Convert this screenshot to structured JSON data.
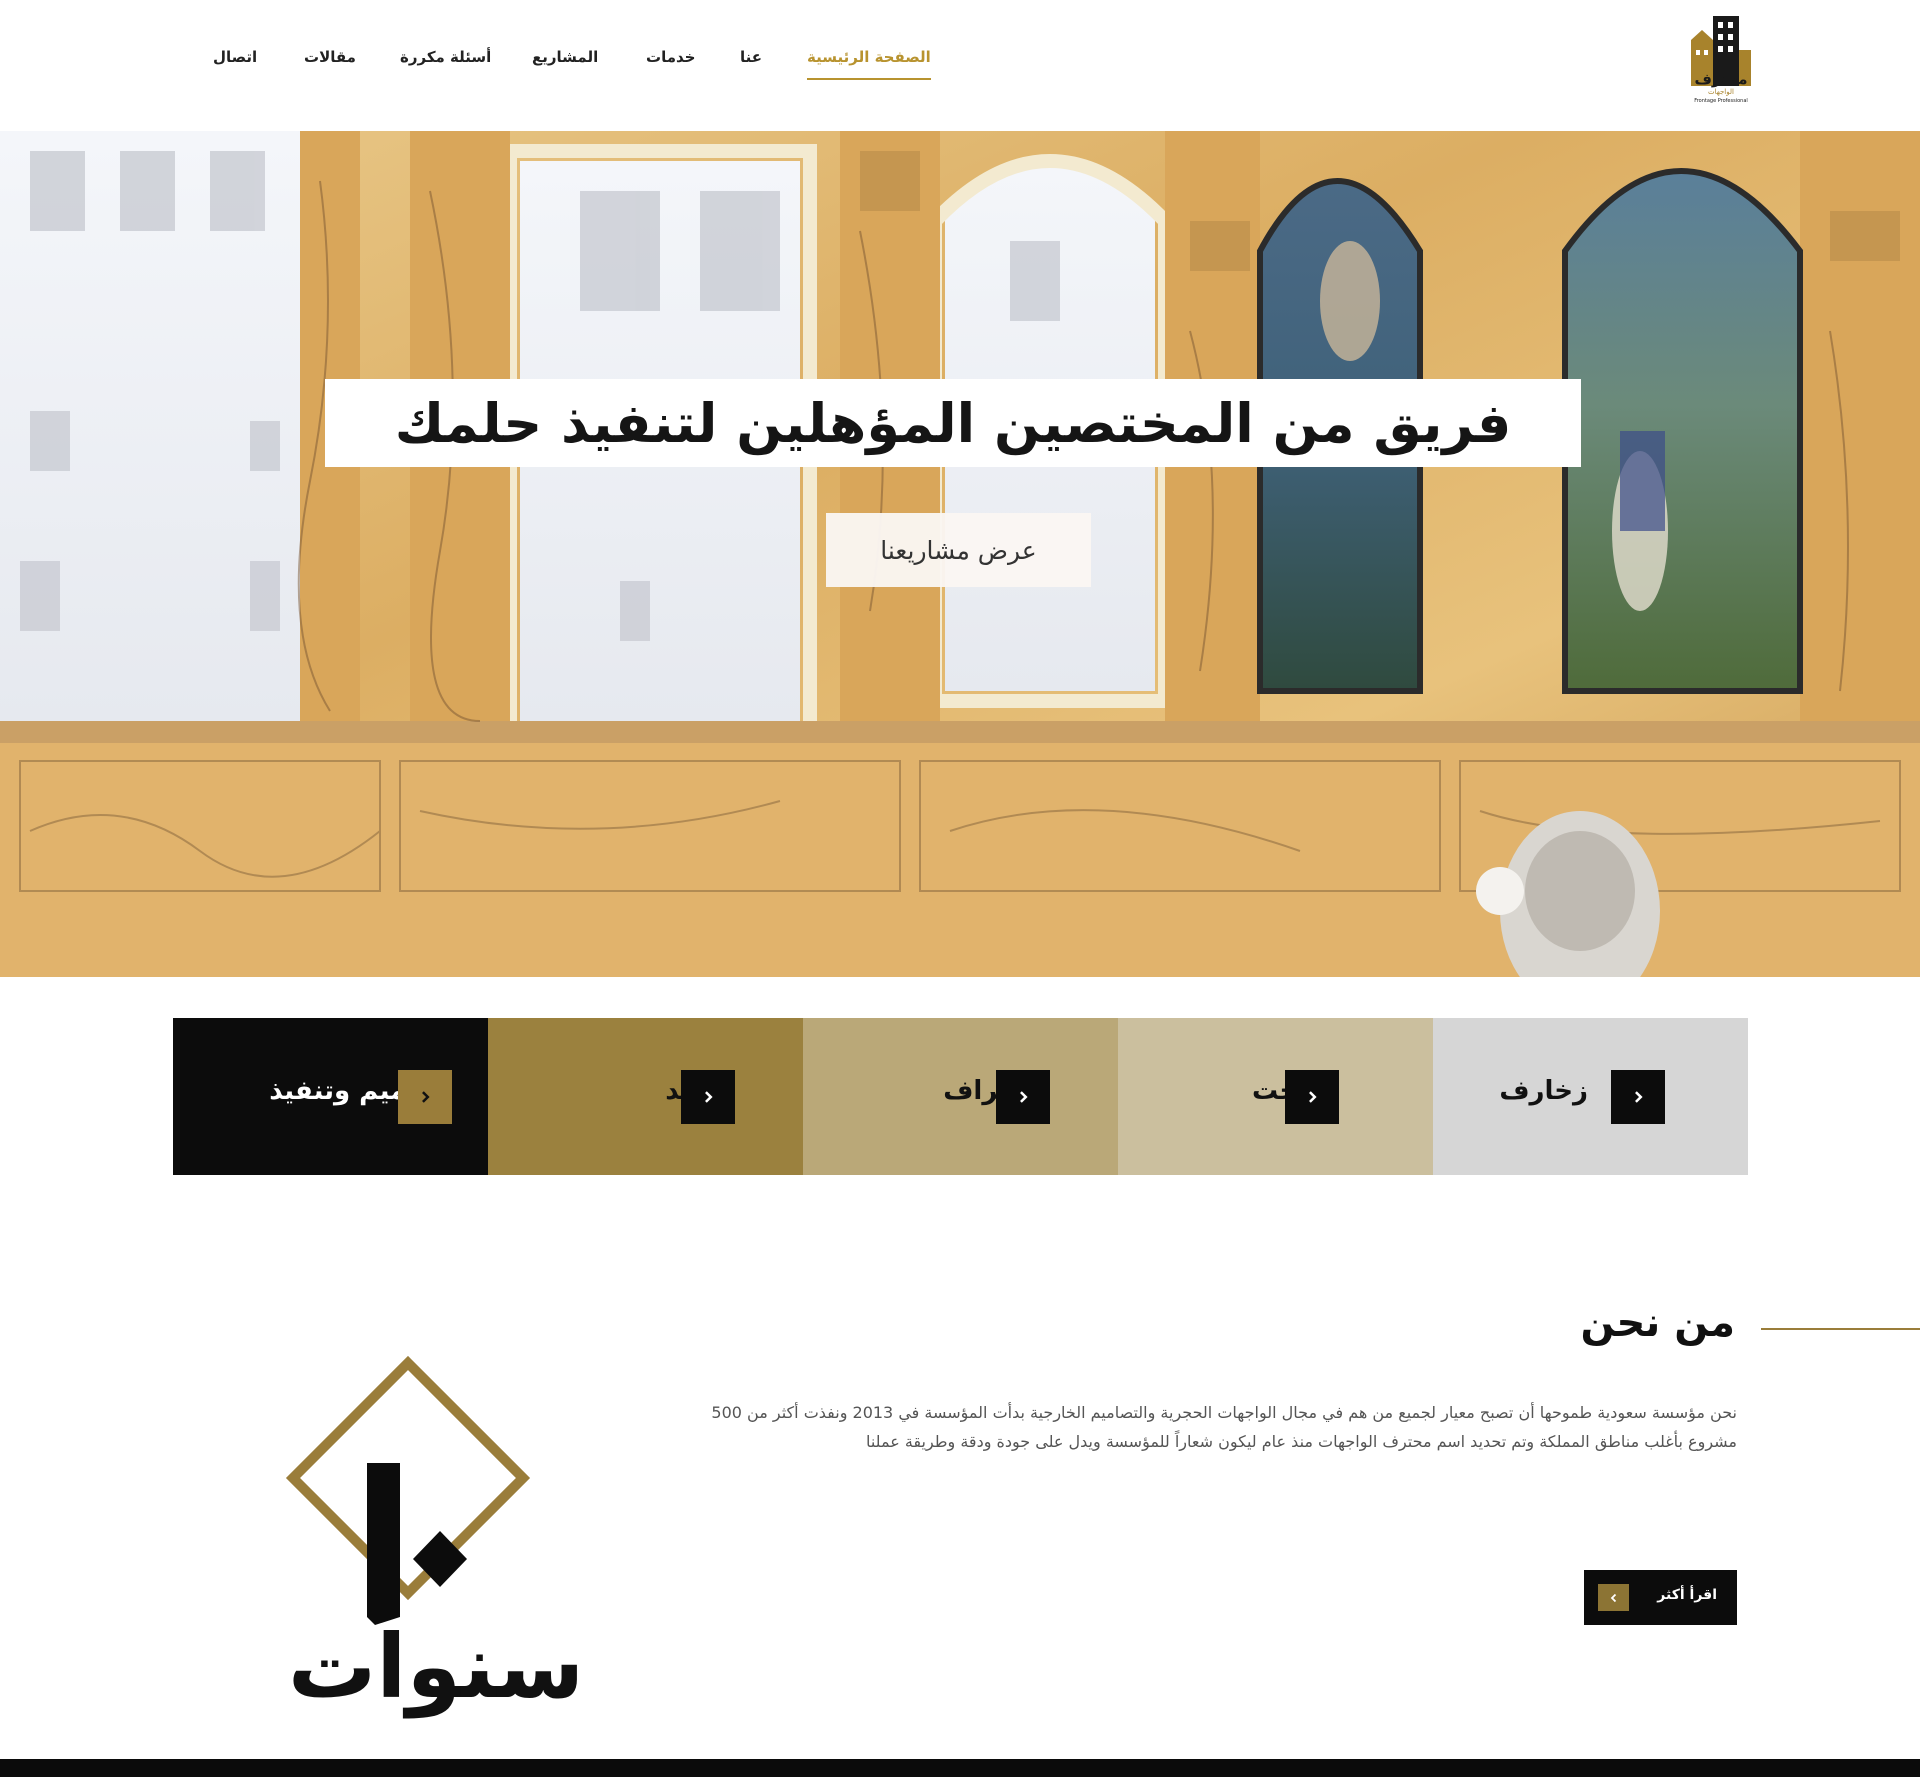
{
  "header": {
    "logo_alt": "محترف الواجهات Frontage Professional",
    "logo_text_ar": "محترف",
    "logo_sub_ar": "الواجهات",
    "logo_sub_en": "Frontage Professional",
    "nav": [
      {
        "label": "الصفحة الرئيسية",
        "active": true
      },
      {
        "label": "عنا",
        "active": false
      },
      {
        "label": "خدمات",
        "active": false
      },
      {
        "label": "المشاريع",
        "active": false
      },
      {
        "label": "أسئلة مكررة",
        "active": false
      },
      {
        "label": "مقالات",
        "active": false
      },
      {
        "label": "اتصال",
        "active": false
      }
    ]
  },
  "hero": {
    "title": "فريق من المختصين المؤهلين لتنفيذ حلمك",
    "button": "عرض مشاريعنا"
  },
  "services": [
    {
      "label": "تصميم وتنفيذ",
      "bg": "#0c0c0c",
      "fg": "#ffffff",
      "arrow_bg": "#9a7d3a"
    },
    {
      "label": "توريد",
      "bg": "#9b813e",
      "fg": "#111111",
      "arrow_bg": "#0c0c0c"
    },
    {
      "label": "اشراف",
      "bg": "#baa878",
      "fg": "#111111",
      "arrow_bg": "#0c0c0c"
    },
    {
      "label": "نحت",
      "bg": "#cbbf9e",
      "fg": "#111111",
      "arrow_bg": "#0c0c0c"
    },
    {
      "label": "زخارف",
      "bg": "#d6d6d6",
      "fg": "#111111",
      "arrow_bg": "#0c0c0c"
    }
  ],
  "about": {
    "title": "من نحن",
    "text": "نحن مؤسسة سعودية طموحها أن تصبح معيار لجميع من هم في مجال الواجهات الحجرية والتصاميم الخارجية بدأت المؤسسة في 2013 ونفذت أكثر من 500 مشروع بأغلب مناطق المملكة وتم تحديد اسم محترف الواجهات منذ عام ليكون شعاراً للمؤسسة ويدل على جودة ودقة وطريقة عملنا",
    "read_more": "اقرأ أكثر",
    "badge_number": "١٠",
    "badge_text": "سنوات"
  },
  "colors": {
    "gold": "#b8932f",
    "dark_gold": "#9a7d3a",
    "black": "#0c0c0c"
  }
}
